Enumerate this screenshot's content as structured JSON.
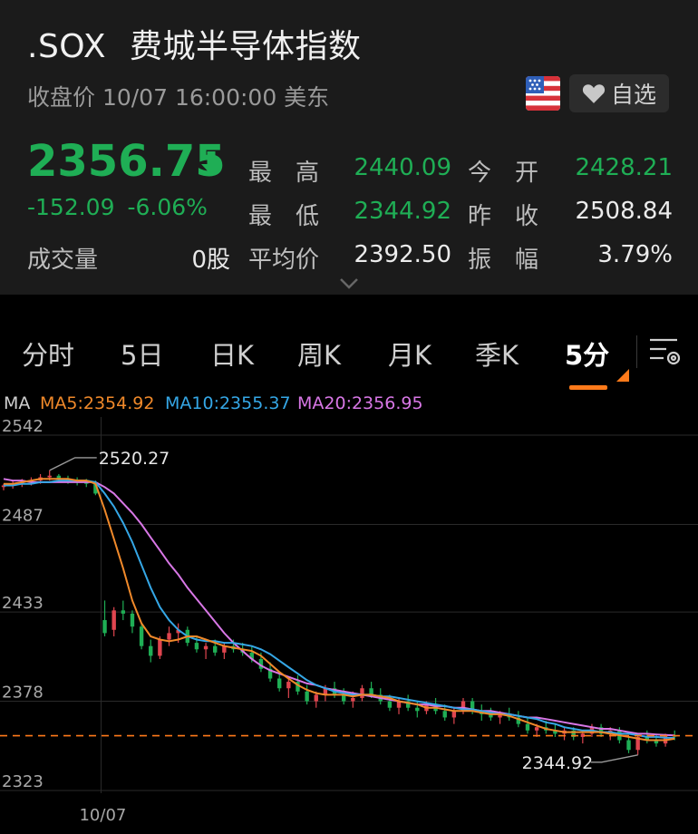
{
  "header": {
    "symbol": ".SOX",
    "name": "费城半导体指数",
    "status": "收盘价 10/07 16:00:00 美东",
    "favorite_label": "自选",
    "flag_icon": "us-flag-icon"
  },
  "quote": {
    "price": "2356.75",
    "change": "-152.09",
    "change_pct": "-6.06%",
    "down_color": "#1fae55",
    "volume_label": "成交量",
    "volume": "0股",
    "stats": [
      {
        "label": "最　高",
        "value": "2440.09",
        "color": "green"
      },
      {
        "label": "今　开",
        "value": "2428.21",
        "color": "green"
      },
      {
        "label": "最　低",
        "value": "2344.92",
        "color": "green"
      },
      {
        "label": "昨　收",
        "value": "2508.84",
        "color": "white"
      },
      {
        "label": "平均价",
        "value": "2392.50",
        "color": "white"
      },
      {
        "label": "振　幅",
        "value": "3.79%",
        "color": "white"
      }
    ]
  },
  "tabs": [
    {
      "label": "分时",
      "active": false
    },
    {
      "label": "5日",
      "active": false
    },
    {
      "label": "日K",
      "active": false
    },
    {
      "label": "周K",
      "active": false
    },
    {
      "label": "月K",
      "active": false
    },
    {
      "label": "季K",
      "active": false
    },
    {
      "label": "5分",
      "active": true
    }
  ],
  "indicators": {
    "ma": "MA",
    "ma5": "MA5:2354.92",
    "ma10": "MA10:2355.37",
    "ma20": "MA20:2356.95",
    "ma5_color": "#f0892a",
    "ma10_color": "#35a7e6",
    "ma20_color": "#d877e6"
  },
  "chart_data": {
    "type": "candlestick",
    "y_ticks": [
      "2542",
      "2487",
      "2433",
      "2378",
      "2323"
    ],
    "ylim": [
      2323,
      2542
    ],
    "x_tick": "10/07",
    "high_label": "2520.27",
    "low_label": "2344.92",
    "last_price": 2356.75,
    "up_color": "#e0454f",
    "down_color": "#1fae55",
    "candles": [
      [
        2510,
        2512,
        2508,
        2511
      ],
      [
        2511,
        2514,
        2509,
        2512
      ],
      [
        2512,
        2515,
        2510,
        2513
      ],
      [
        2513,
        2516,
        2511,
        2514
      ],
      [
        2514,
        2518,
        2512,
        2516
      ],
      [
        2516,
        2520.27,
        2514,
        2517
      ],
      [
        2517,
        2518,
        2513,
        2515
      ],
      [
        2515,
        2517,
        2512,
        2514
      ],
      [
        2514,
        2516,
        2511,
        2513
      ],
      [
        2513,
        2515,
        2510,
        2512
      ],
      [
        2512,
        2514,
        2505,
        2506
      ],
      [
        2428,
        2440.09,
        2418,
        2420
      ],
      [
        2422,
        2436,
        2418,
        2434
      ],
      [
        2434,
        2440,
        2428,
        2432
      ],
      [
        2432,
        2434,
        2420,
        2424
      ],
      [
        2424,
        2426,
        2410,
        2412
      ],
      [
        2412,
        2416,
        2402,
        2406
      ],
      [
        2406,
        2418,
        2404,
        2416
      ],
      [
        2416,
        2424,
        2412,
        2420
      ],
      [
        2420,
        2426,
        2414,
        2422
      ],
      [
        2422,
        2424,
        2412,
        2414
      ],
      [
        2414,
        2418,
        2408,
        2410
      ],
      [
        2410,
        2414,
        2404,
        2412
      ],
      [
        2412,
        2416,
        2406,
        2408
      ],
      [
        2408,
        2414,
        2404,
        2412
      ],
      [
        2412,
        2416,
        2408,
        2410
      ],
      [
        2410,
        2414,
        2406,
        2408
      ],
      [
        2408,
        2412,
        2402,
        2404
      ],
      [
        2404,
        2408,
        2396,
        2398
      ],
      [
        2398,
        2402,
        2390,
        2392
      ],
      [
        2392,
        2396,
        2384,
        2386
      ],
      [
        2386,
        2392,
        2380,
        2390
      ],
      [
        2390,
        2394,
        2382,
        2384
      ],
      [
        2384,
        2388,
        2376,
        2378
      ],
      [
        2378,
        2384,
        2374,
        2382
      ],
      [
        2382,
        2388,
        2378,
        2386
      ],
      [
        2386,
        2390,
        2380,
        2382
      ],
      [
        2382,
        2386,
        2376,
        2378
      ],
      [
        2378,
        2384,
        2374,
        2380
      ],
      [
        2380,
        2388,
        2378,
        2386
      ],
      [
        2386,
        2390,
        2380,
        2382
      ],
      [
        2382,
        2386,
        2376,
        2378
      ],
      [
        2378,
        2382,
        2372,
        2374
      ],
      [
        2374,
        2380,
        2370,
        2378
      ],
      [
        2378,
        2382,
        2372,
        2374
      ],
      [
        2374,
        2378,
        2368,
        2372
      ],
      [
        2372,
        2378,
        2370,
        2376
      ],
      [
        2376,
        2380,
        2370,
        2372
      ],
      [
        2372,
        2376,
        2366,
        2368
      ],
      [
        2368,
        2374,
        2364,
        2372
      ],
      [
        2372,
        2380,
        2370,
        2378
      ],
      [
        2378,
        2380,
        2370,
        2372
      ],
      [
        2372,
        2376,
        2366,
        2370
      ],
      [
        2370,
        2374,
        2366,
        2368
      ],
      [
        2368,
        2372,
        2364,
        2370
      ],
      [
        2370,
        2374,
        2366,
        2368
      ],
      [
        2368,
        2372,
        2362,
        2364
      ],
      [
        2364,
        2368,
        2358,
        2360
      ],
      [
        2360,
        2364,
        2356,
        2362
      ],
      [
        2362,
        2366,
        2358,
        2360
      ],
      [
        2360,
        2364,
        2356,
        2358
      ],
      [
        2358,
        2362,
        2354,
        2360
      ],
      [
        2360,
        2362,
        2354,
        2356
      ],
      [
        2356,
        2360,
        2352,
        2358
      ],
      [
        2358,
        2364,
        2356,
        2362
      ],
      [
        2362,
        2364,
        2356,
        2358
      ],
      [
        2358,
        2362,
        2354,
        2360
      ],
      [
        2360,
        2362,
        2352,
        2354
      ],
      [
        2354,
        2356,
        2346,
        2348
      ],
      [
        2348,
        2358,
        2344.92,
        2356
      ],
      [
        2356,
        2360,
        2352,
        2354
      ],
      [
        2354,
        2358,
        2350,
        2352
      ],
      [
        2352,
        2358,
        2350,
        2357
      ],
      [
        2357,
        2360,
        2354,
        2356.75
      ]
    ],
    "ma5": [
      2512,
      2512,
      2513,
      2514,
      2515,
      2515,
      2515,
      2515,
      2514,
      2514,
      2512,
      2496,
      2478,
      2460,
      2440,
      2426,
      2418,
      2416,
      2415,
      2416,
      2418,
      2418,
      2416,
      2414,
      2412,
      2411,
      2410,
      2409,
      2406,
      2401,
      2396,
      2392,
      2388,
      2385,
      2383,
      2382,
      2382,
      2382,
      2381,
      2382,
      2382,
      2381,
      2380,
      2378,
      2377,
      2376,
      2374,
      2374,
      2373,
      2372,
      2372,
      2372,
      2371,
      2370,
      2370,
      2369,
      2367,
      2365,
      2363,
      2361,
      2360,
      2359,
      2359,
      2359,
      2359,
      2359,
      2358,
      2357,
      2356,
      2355,
      2354,
      2354,
      2354,
      2354.92
    ],
    "ma10": [
      2511,
      2511,
      2512,
      2512,
      2513,
      2513,
      2514,
      2514,
      2514,
      2514,
      2513,
      2506,
      2498,
      2488,
      2476,
      2462,
      2448,
      2436,
      2428,
      2422,
      2418,
      2416,
      2415,
      2415,
      2414,
      2414,
      2413,
      2412,
      2410,
      2407,
      2403,
      2399,
      2395,
      2391,
      2388,
      2386,
      2384,
      2383,
      2382,
      2382,
      2382,
      2381,
      2381,
      2380,
      2379,
      2378,
      2377,
      2376,
      2375,
      2374,
      2373,
      2373,
      2372,
      2371,
      2370,
      2370,
      2369,
      2368,
      2367,
      2365,
      2364,
      2362,
      2361,
      2360,
      2360,
      2359,
      2359,
      2358,
      2358,
      2357,
      2356,
      2356,
      2355.5,
      2355.37
    ],
    "ma20": [
      2515,
      2514,
      2514,
      2513,
      2513,
      2513,
      2513,
      2513,
      2513,
      2513,
      2513,
      2510,
      2506,
      2500,
      2494,
      2487,
      2479,
      2471,
      2463,
      2456,
      2448,
      2441,
      2434,
      2427,
      2420,
      2414,
      2409,
      2404,
      2400,
      2397,
      2395,
      2393,
      2391,
      2389,
      2388,
      2386,
      2385,
      2384,
      2383,
      2382,
      2381,
      2380,
      2379,
      2378,
      2377,
      2376,
      2376,
      2375,
      2375,
      2374,
      2374,
      2373,
      2372,
      2372,
      2371,
      2370,
      2369,
      2368,
      2368,
      2367,
      2366,
      2365,
      2364,
      2363,
      2362,
      2361,
      2361,
      2360,
      2359,
      2358,
      2358,
      2357.5,
      2357.2,
      2356.95
    ]
  }
}
